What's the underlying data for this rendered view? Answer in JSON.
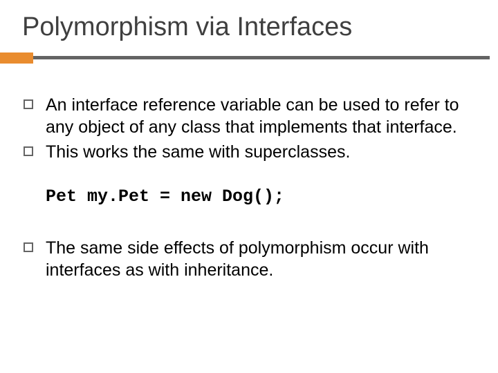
{
  "title": "Polymorphism via Interfaces",
  "bullets": {
    "b1": "An interface reference variable can be used to refer to any object of any class that implements that interface.",
    "b2": "This works the same with superclasses.",
    "b3": "The same side effects of polymorphism occur with interfaces as with inheritance."
  },
  "code": "Pet my.Pet = new Dog();"
}
